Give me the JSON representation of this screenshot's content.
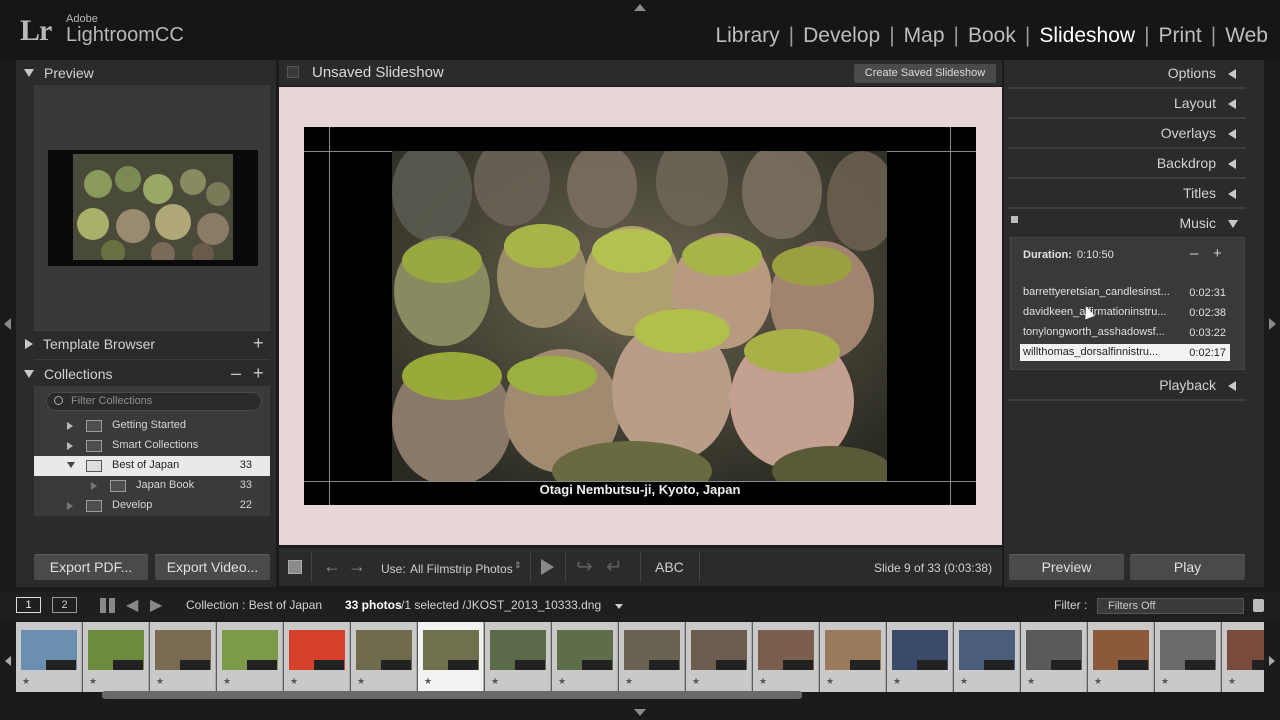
{
  "app": {
    "logo": "Lr",
    "brand_line1": "Adobe",
    "brand_line2": "LightroomCC"
  },
  "modules": [
    {
      "label": "Library",
      "active": false
    },
    {
      "label": "Develop",
      "active": false
    },
    {
      "label": "Map",
      "active": false
    },
    {
      "label": "Book",
      "active": false
    },
    {
      "label": "Slideshow",
      "active": true
    },
    {
      "label": "Print",
      "active": false
    },
    {
      "label": "Web",
      "active": false
    }
  ],
  "module_separator": "|",
  "left_panel": {
    "preview_title": "Preview",
    "template_browser_title": "Template Browser",
    "collections_title": "Collections",
    "add_symbol": "+",
    "minus_symbol": "–",
    "filter_placeholder": "Filter Collections",
    "collections": [
      {
        "name": "Getting Started",
        "count": "",
        "expanded": false,
        "selected": false
      },
      {
        "name": "Smart Collections",
        "count": "",
        "expanded": false,
        "selected": false
      },
      {
        "name": "Best of Japan",
        "count": "33",
        "expanded": true,
        "selected": true
      },
      {
        "name": "Japan Book",
        "count": "33",
        "expanded": false,
        "selected": false
      },
      {
        "name": "Develop",
        "count": "22",
        "expanded": false,
        "selected": false
      }
    ],
    "export_pdf": "Export PDF...",
    "export_video": "Export Video..."
  },
  "center": {
    "title": "Unsaved Slideshow",
    "create_button": "Create Saved Slideshow",
    "caption": "Otagi Nembutsu-ji, Kyoto,  Japan",
    "stage_color": "#e8d7d8",
    "toolbar": {
      "use_label": "Use:",
      "use_value": "All Filmstrip Photos",
      "text_button": "ABC",
      "slide_info": "Slide 9 of 33 (0:03:38)"
    }
  },
  "right_panel": {
    "sections": [
      "Options",
      "Layout",
      "Overlays",
      "Backdrop",
      "Titles",
      "Music",
      "Playback"
    ],
    "music": {
      "duration_label": "Duration:",
      "duration_value": "0:10:50",
      "minus": "–",
      "plus": "+",
      "tracks": [
        {
          "name": "barrettyeretsian_candlesinst...",
          "duration": "0:02:31",
          "selected": false
        },
        {
          "name": "davidkeen_affirmationinstru...",
          "duration": "0:02:38",
          "selected": false
        },
        {
          "name": "tonylongworth_asshadowsf...",
          "duration": "0:03:22",
          "selected": false
        },
        {
          "name": "willthomas_dorsalfinnistru...",
          "duration": "0:02:17",
          "selected": true
        }
      ]
    },
    "preview_button": "Preview",
    "play_button": "Play"
  },
  "filmstrip_bar": {
    "view1": "1",
    "view2": "2",
    "collection_text": "Collection : Best of Japan",
    "photo_count": "33 photos",
    "selection_text": " /1 selected /JKOST_2013_10333.dng",
    "filter_label": "Filter :",
    "filter_value": "Filters Off"
  },
  "filmstrip": {
    "selected_index": 6,
    "thumbs": [
      "#6b8fb0",
      "#6d8b3e",
      "#7a6a52",
      "#7c9a4a",
      "#d4402a",
      "#6e6a4c",
      "#70704e",
      "#5b6a48",
      "#5e6e4a",
      "#6a6250",
      "#6c5e4e",
      "#7a5e4e",
      "#9a7a5a",
      "#3a4a6a",
      "#4a5e7a",
      "#5a5a5a",
      "#8a5a3a",
      "#6a6a6a",
      "#7a4a3a"
    ],
    "star": "★"
  }
}
